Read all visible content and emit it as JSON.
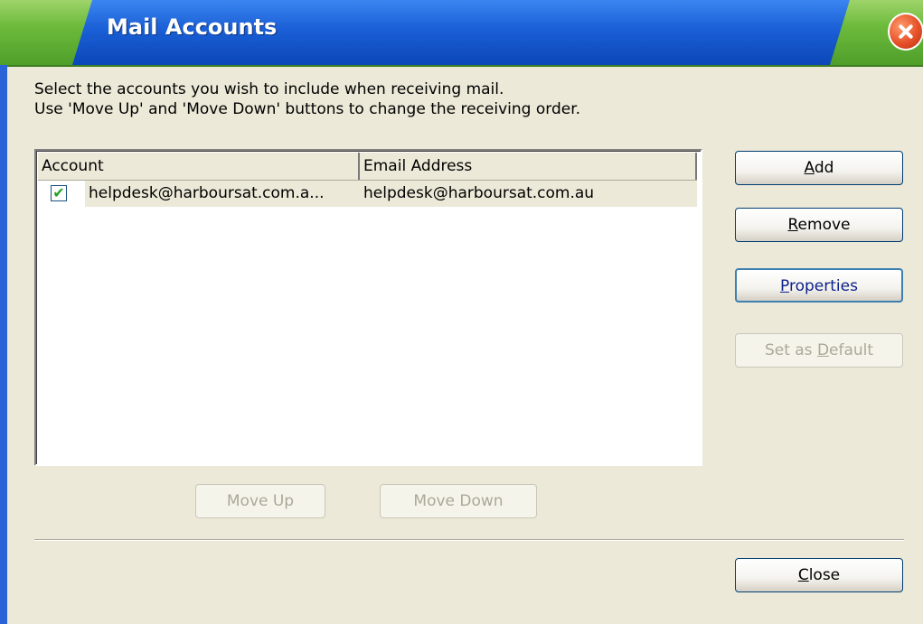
{
  "window": {
    "title": "Mail Accounts"
  },
  "instructions": {
    "line1": "Select the accounts you wish to include when receiving mail.",
    "line2": "Use 'Move Up' and 'Move Down' buttons to change the receiving order."
  },
  "list": {
    "columns": [
      "Account",
      "Email Address"
    ],
    "rows": [
      {
        "checked": true,
        "account": "helpdesk@harboursat.com.a...",
        "email": "helpdesk@harboursat.com.au"
      }
    ]
  },
  "buttons": {
    "add": {
      "pre": "",
      "mnemonic": "A",
      "post": "dd"
    },
    "remove": {
      "pre": "",
      "mnemonic": "R",
      "post": "emove"
    },
    "properties": {
      "pre": "",
      "mnemonic": "P",
      "post": "roperties"
    },
    "set_default": {
      "pre": "Set as ",
      "mnemonic": "D",
      "post": "efault"
    },
    "move_up": "Move Up",
    "move_down": "Move Down",
    "close": {
      "pre": "",
      "mnemonic": "C",
      "post": "lose"
    }
  }
}
